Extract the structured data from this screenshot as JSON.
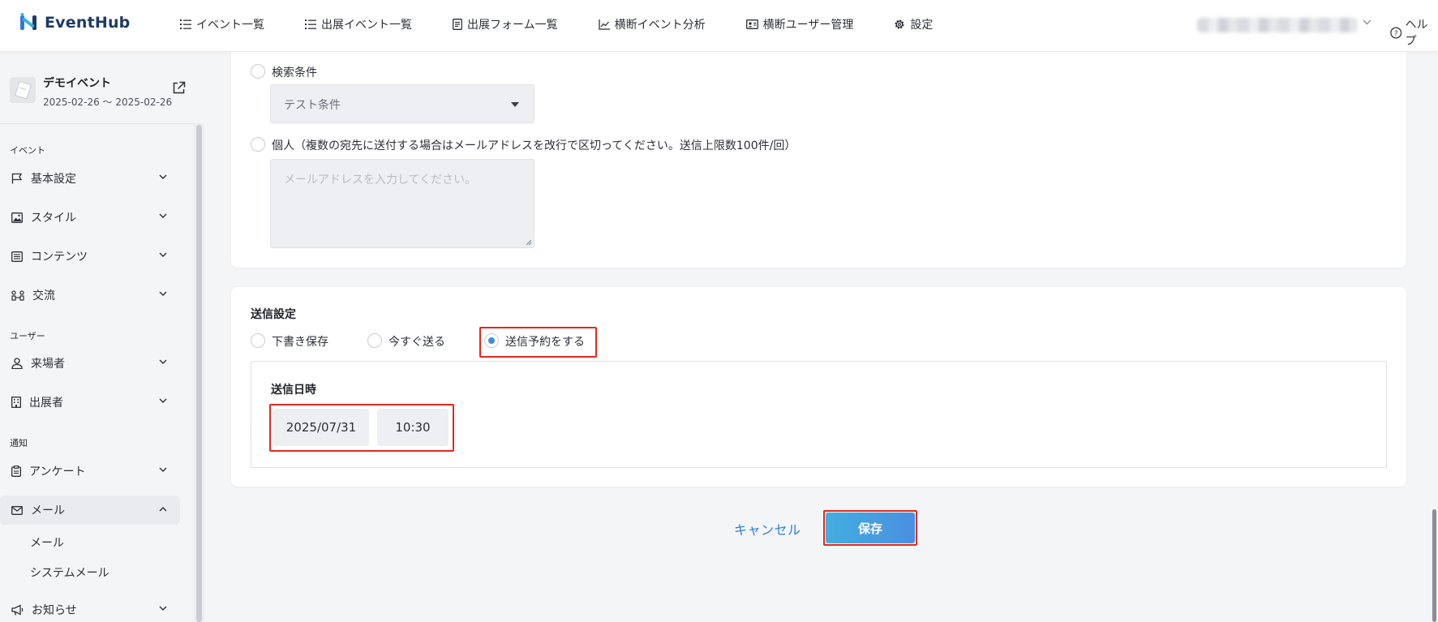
{
  "app": {
    "logo_text": "EventHub"
  },
  "nav": {
    "items": [
      {
        "label": "イベント一覧",
        "icon": "list-icon"
      },
      {
        "label": "出展イベント一覧",
        "icon": "list-icon"
      },
      {
        "label": "出展フォーム一覧",
        "icon": "form-icon"
      },
      {
        "label": "横断イベント分析",
        "icon": "chart-icon"
      },
      {
        "label": "横断ユーザー管理",
        "icon": "id-card-icon"
      },
      {
        "label": "設定",
        "icon": "gear-icon"
      }
    ],
    "help_label": "ヘルプ"
  },
  "event": {
    "name": "デモイベント",
    "dates": "2025-02-26 ～ 2025-02-26"
  },
  "sidebar": {
    "sections": {
      "event": "イベント",
      "user": "ユーザー",
      "notice": "通知"
    },
    "items": [
      {
        "label": "基本設定",
        "icon": "flag-icon"
      },
      {
        "label": "スタイル",
        "icon": "image-icon"
      },
      {
        "label": "コンテンツ",
        "icon": "list-box-icon"
      },
      {
        "label": "交流",
        "icon": "network-icon"
      },
      {
        "label": "来場者",
        "icon": "person-icon"
      },
      {
        "label": "出展者",
        "icon": "building-icon"
      },
      {
        "label": "アンケート",
        "icon": "clipboard-icon"
      },
      {
        "label": "メール",
        "icon": "mail-icon"
      },
      {
        "label": "お知らせ",
        "icon": "megaphone-icon"
      }
    ],
    "mail_sub": [
      "メール",
      "システムメール"
    ]
  },
  "recipients": {
    "search_label": "検索条件",
    "search_value": "テスト条件",
    "individual_label": "個人（複数の宛先に送付する場合はメールアドレスを改行で区切ってください。送信上限数100件/回）",
    "email_placeholder": "メールアドレスを入力してください。"
  },
  "send": {
    "title": "送信設定",
    "options": [
      "下書き保存",
      "今すぐ送る",
      "送信予約をする"
    ],
    "selected": "送信予約をする",
    "datetime_label": "送信日時",
    "date": "2025/07/31",
    "time": "10:30"
  },
  "actions": {
    "cancel": "キャンセル",
    "save": "保存"
  },
  "colors": {
    "accent": "#3d8ce0",
    "highlight": "#e12a1f",
    "link": "#2f7fd1"
  }
}
